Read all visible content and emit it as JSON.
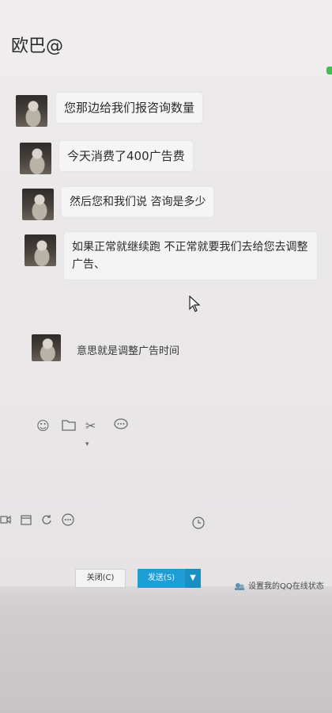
{
  "window": {
    "title": "欧巴@"
  },
  "messages": [
    {
      "text": "您那边给我们报咨询数量"
    },
    {
      "text": "今天消费了400广告费"
    },
    {
      "text": "然后您和我们说 咨询是多少"
    },
    {
      "text": "如果正常就继续跑 不正常就要我们去给您去调整广告、"
    },
    {
      "text": "意思就是调整广告时间"
    }
  ],
  "toolbar_top": {
    "icons": [
      "emoji-icon",
      "folder-icon",
      "scissors-icon",
      "chat-bubble-icon"
    ]
  },
  "toolbar_bottom": {
    "icons": [
      "video-icon",
      "calendar-icon",
      "refresh-icon",
      "more-icon",
      "clock-icon"
    ]
  },
  "footer": {
    "close_label": "关闭(C)",
    "send_label": "发送(S)",
    "send_dropdown": "▼",
    "status_text": "设置我的QQ在线状态"
  },
  "colors": {
    "send_button": "#1f9ed6",
    "online_indicator": "#3fbf4f"
  }
}
